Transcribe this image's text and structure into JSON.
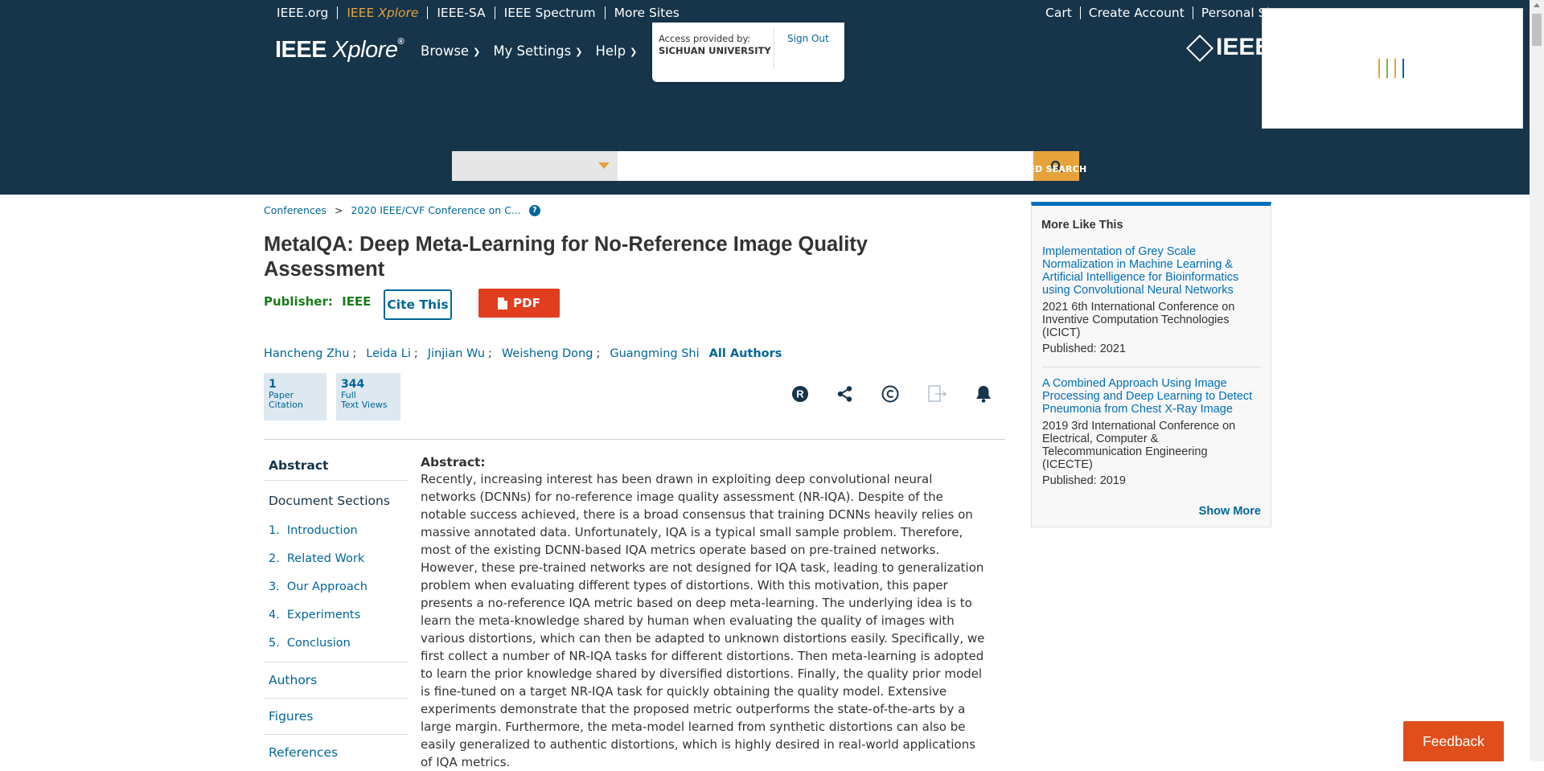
{
  "topbar": {
    "links": [
      "IEEE.org",
      "IEEE",
      "Xplore",
      "IEEE-SA",
      "IEEE Spectrum",
      "More Sites"
    ],
    "right_links": [
      "Cart",
      "Create Account",
      "Personal Sign I"
    ]
  },
  "header": {
    "logo_main": "IEEE",
    "logo_italic": "Xplore",
    "logo_reg": "®",
    "nav": [
      "Browse",
      "My Settings",
      "Help"
    ],
    "access_label": "Access provided by:",
    "access_university": "SICHUAN UNIVERSITY",
    "sign_out": "Sign Out",
    "ieee_logo": "IEEE"
  },
  "search": {
    "placeholder": "",
    "advanced": "ADVANCED SEARCH"
  },
  "breadcrumb": [
    "Conferences",
    ">",
    "2020 IEEE/CVF Conference on C..."
  ],
  "paper": {
    "title": "MetaIQA: Deep Meta-Learning for No-Reference Image Quality Assessment",
    "publisher_label": "Publisher:",
    "publisher_value": "IEEE",
    "cite_label": "Cite This",
    "pdf_label": "PDF",
    "authors": [
      "Hancheng Zhu",
      "Leida Li",
      "Jinjian Wu",
      "Weisheng Dong",
      "Guangming Shi"
    ],
    "author_sep": ";",
    "all_authors": "All Authors",
    "metrics": [
      {
        "number": "1",
        "line1": "Paper",
        "line2": "Citation"
      },
      {
        "number": "344",
        "line1": "Full",
        "line2": "Text Views"
      }
    ]
  },
  "sidebar": {
    "abstract": "Abstract",
    "sections_title": "Document Sections",
    "sections": [
      {
        "num": "1.",
        "label": "Introduction"
      },
      {
        "num": "2.",
        "label": "Related Work"
      },
      {
        "num": "3.",
        "label": "Our Approach"
      },
      {
        "num": "4.",
        "label": "Experiments"
      },
      {
        "num": "5.",
        "label": "Conclusion"
      }
    ],
    "authors": "Authors",
    "figures": "Figures",
    "references": "References"
  },
  "abstract": {
    "heading": "Abstract:",
    "text": "Recently, increasing interest has been drawn in exploiting deep convolutional neural networks (DCNNs) for no-reference image quality assessment (NR-IQA). Despite of the notable success achieved, there is a broad consensus that training DCNNs heavily relies on massive annotated data. Unfortunately, IQA is a typical small sample problem. Therefore, most of the existing DCNN-based IQA metrics operate based on pre-trained networks. However, these pre-trained networks are not designed for IQA task, leading to generalization problem when evaluating different types of distortions. With this motivation, this paper presents a no-reference IQA metric based on deep meta-learning. The underlying idea is to learn the meta-knowledge shared by human when evaluating the quality of images with various distortions, which can then be adapted to unknown distortions easily. Specifically, we first collect a number of NR-IQA tasks for different distortions. Then meta-learning is adopted to learn the prior knowledge shared by diversified distortions. Finally, the quality prior model is fine-tuned on a target NR-IQA task for quickly obtaining the quality model. Extensive experiments demonstrate that the proposed metric outperforms the state-of-the-arts by a large margin. Furthermore, the meta-model learned from synthetic distortions can also be easily generalized to authentic distortions, which is highly desired in real-world applications of IQA metrics."
  },
  "more_like_this": {
    "heading": "More Like This",
    "items": [
      {
        "title": "Implementation of Grey Scale Normalization in Machine Learning & Artificial Intelligence for Bioinformatics using Convolutional Neural Networks",
        "conference": "2021 6th International Conference on Inventive Computation Technologies (ICICT)",
        "published": "Published: 2021"
      },
      {
        "title": "A Combined Approach Using Image Processing and Deep Learning to Detect Pneumonia from Chest X-Ray Image",
        "conference": "2019 3rd International Conference on Electrical, Computer & Telecommunication Engineering (ICECTE)",
        "published": "Published: 2019"
      }
    ],
    "show_more": "Show More"
  },
  "feedback": "Feedback",
  "colors": {
    "header_bg": "#16344a",
    "accent_orange": "#e6a33b",
    "link_blue": "#006699",
    "pdf_red": "#e03e1e",
    "feedback_orange": "#e04e1b",
    "publisher_green": "#1a7a1a"
  }
}
